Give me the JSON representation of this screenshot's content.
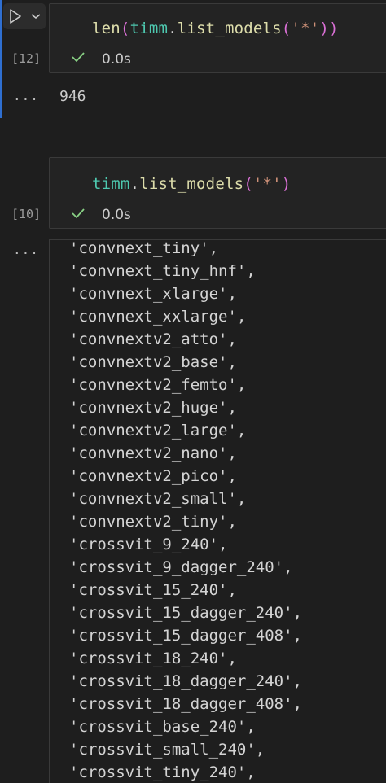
{
  "cell1": {
    "code_tokens": {
      "fn": "len",
      "p1": "(",
      "module": "timm",
      "dot": ".",
      "method": "list_models",
      "p2": "(",
      "arg": "'*'",
      "p3": ")",
      "p4": ")"
    },
    "exec_count": "[12]",
    "status_icon": "check-icon",
    "duration": "0.0s",
    "output_marker": "...",
    "output": "946"
  },
  "cell2": {
    "code_tokens": {
      "module": "timm",
      "dot": ".",
      "method": "list_models",
      "p1": "(",
      "arg": "'*'",
      "p2": ")"
    },
    "exec_count": "[10]",
    "status_icon": "check-icon",
    "duration": "0.0s",
    "output_marker": "...",
    "output_lines": [
      "'convnext_tiny',",
      "'convnext_tiny_hnf',",
      "'convnext_xlarge',",
      "'convnext_xxlarge',",
      "'convnextv2_atto',",
      "'convnextv2_base',",
      "'convnextv2_femto',",
      "'convnextv2_huge',",
      "'convnextv2_large',",
      "'convnextv2_nano',",
      "'convnextv2_pico',",
      "'convnextv2_small',",
      "'convnextv2_tiny',",
      "'crossvit_9_240',",
      "'crossvit_9_dagger_240',",
      "'crossvit_15_240',",
      "'crossvit_15_dagger_240',",
      "'crossvit_15_dagger_408',",
      "'crossvit_18_240',",
      "'crossvit_18_dagger_240',",
      "'crossvit_18_dagger_408',",
      "'crossvit_base_240',",
      "'crossvit_small_240',",
      "'crossvit_tiny_240',"
    ]
  },
  "toolbar": {
    "run_icon": "play-icon",
    "menu_icon": "chevron-down-icon"
  },
  "colors": {
    "background": "#1e1e1e",
    "success": "#89d185",
    "accent": "#2f6fd1"
  }
}
